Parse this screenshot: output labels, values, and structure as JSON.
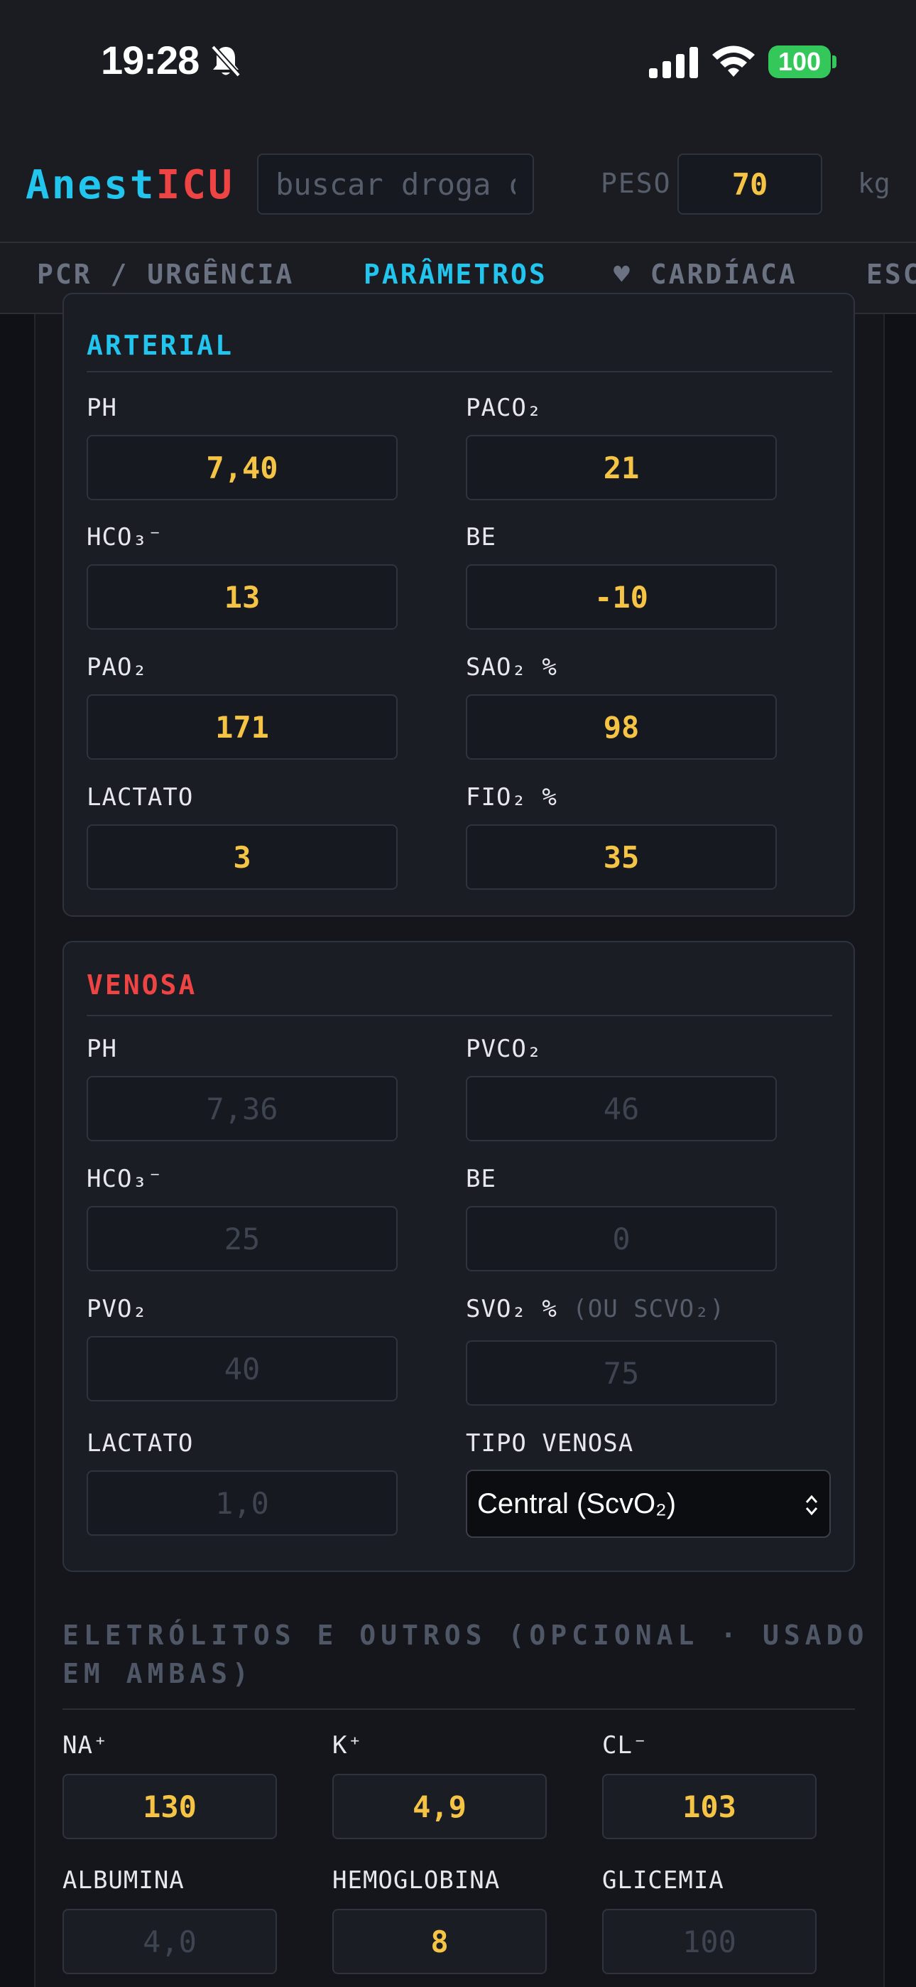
{
  "status_bar": {
    "time": "19:28",
    "battery": "100"
  },
  "app": {
    "logo_part1": "Anest",
    "logo_part2": "ICU",
    "search_placeholder": "buscar droga ou procedimento",
    "weight_label": "PESO",
    "weight_value": "70",
    "weight_unit": "kg"
  },
  "tabs": [
    "PCR / URGÊNCIA",
    "PARÂMETROS",
    "♥ CARDÍACA",
    "ESCORES"
  ],
  "active_tab": "PARÂMETROS",
  "arterial": {
    "title": "ARTERIAL",
    "fields": [
      {
        "label": "PH",
        "value": "7,40"
      },
      {
        "label": "PACO₂",
        "value": "21"
      },
      {
        "label": "HCO₃⁻",
        "value": "13"
      },
      {
        "label": "BE",
        "value": "-10"
      },
      {
        "label": "PAO₂",
        "value": "171"
      },
      {
        "label": "SAO₂ %",
        "value": "98"
      },
      {
        "label": "LACTATO",
        "value": "3"
      },
      {
        "label": "FIO₂ %",
        "value": "35"
      }
    ]
  },
  "venosa": {
    "title": "VENOSA",
    "fields": [
      {
        "label": "PH",
        "placeholder": "7,36"
      },
      {
        "label": "PVCO₂",
        "placeholder": "46"
      },
      {
        "label": "HCO₃⁻",
        "placeholder": "25"
      },
      {
        "label": "BE",
        "placeholder": "0"
      },
      {
        "label": "PVO₂",
        "placeholder": "40"
      },
      {
        "label": "SVO₂ %",
        "label_note": "(OU SCVO₂)",
        "placeholder": "75"
      },
      {
        "label": "LACTATO",
        "placeholder": "1,0"
      }
    ],
    "type_label": "TIPO VENOSA",
    "type_selected": "Central (ScvO₂)"
  },
  "eletrolitos": {
    "title_line1": "ELETRÓLITOS E OUTROS (OPCIONAL · USADO",
    "title_line2": "EM AMBAS)",
    "fields": [
      {
        "label": "NA⁺",
        "value": "130"
      },
      {
        "label": "K⁺",
        "value": "4,9"
      },
      {
        "label": "CL⁻",
        "value": "103"
      },
      {
        "label": "ALBUMINA",
        "placeholder": "4,0"
      },
      {
        "label": "HEMOGLOBINA",
        "value": "8"
      },
      {
        "label": "GLICEMIA",
        "placeholder": "100"
      }
    ]
  },
  "colors": {
    "accent_cyan": "#22c5ee",
    "accent_red": "#ef4444",
    "value_yellow": "#f5c445",
    "battery_green": "#34c759"
  }
}
